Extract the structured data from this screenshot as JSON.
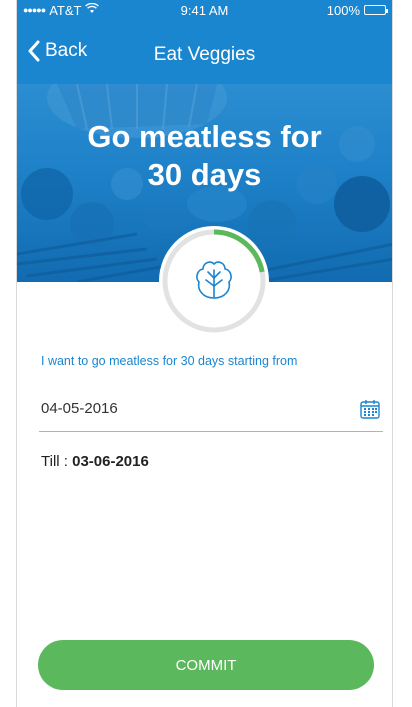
{
  "status_bar": {
    "carrier": "AT&T",
    "time": "9:41 AM",
    "battery": "100%",
    "battery_level": 1.0
  },
  "nav": {
    "back_label": "Back",
    "title": "Eat Veggies"
  },
  "hero": {
    "title_line1": "Go meatless for",
    "title_line2": "30 days"
  },
  "progress": {
    "fraction": 0.22,
    "icon": "lettuce-icon",
    "track_color": "#e2e2e2",
    "fill_color": "#5cb85c"
  },
  "form": {
    "prompt": "I want to go meatless for 30 days starting from",
    "start_date": "04-05-2016",
    "till_label": "Till : ",
    "till_date": "03-06-2016"
  },
  "commit": {
    "label": "COMMIT"
  },
  "colors": {
    "primary": "#1a86d0",
    "accent_green": "#5cb85c"
  }
}
